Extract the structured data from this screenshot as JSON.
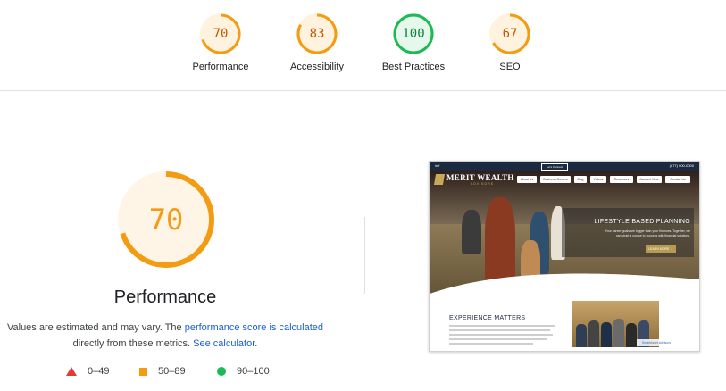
{
  "scores": [
    {
      "label": "Performance",
      "value": "70",
      "score": 70,
      "color": "#f39c12",
      "bg": "#fff3e0",
      "text_color": "#c05a00"
    },
    {
      "label": "Accessibility",
      "value": "83",
      "score": 83,
      "color": "#f39c12",
      "bg": "#fff3e0",
      "text_color": "#c05a00"
    },
    {
      "label": "Best Practices",
      "value": "100",
      "score": 100,
      "color": "#1db954",
      "bg": "#e6f7ec",
      "text_color": "#0b8043"
    },
    {
      "label": "SEO",
      "value": "67",
      "score": 67,
      "color": "#f39c12",
      "bg": "#fff3e0",
      "text_color": "#c05a00"
    }
  ],
  "main": {
    "score": "70",
    "score_fraction": 0.7,
    "title": "Performance",
    "desc_part1": "Values are estimated and may vary. The",
    "desc_link1": "performance score is calculated",
    "desc_part2": "directly from these metrics.",
    "desc_link2": "See calculator",
    "desc_end": "."
  },
  "legend": [
    {
      "range": "0–49",
      "shape": "triangle",
      "color": "#e53935"
    },
    {
      "range": "50–89",
      "shape": "square",
      "color": "#f39c12"
    },
    {
      "range": "90–100",
      "shape": "circle",
      "color": "#1db954"
    }
  ],
  "screenshot": {
    "client_btn": "Let's Connect",
    "phone": "(877) 000-0000",
    "logo_main": "MERIT WEALTH",
    "logo_sub": "ADVISORS",
    "nav": [
      "About Us",
      "Business Owners",
      "Blog",
      "Videos",
      "Resources",
      "Account View",
      "Contact Us"
    ],
    "hero_heading": "LIFESTYLE BASED PLANNING",
    "hero_text": "Your career goals are bigger than your finances. Together, we can chart a course to success with financial solutions.",
    "hero_button": "LEARN MORE →",
    "section_heading": "EXPERIENCE MATTERS",
    "badge": "SmartAsset Advisors"
  }
}
